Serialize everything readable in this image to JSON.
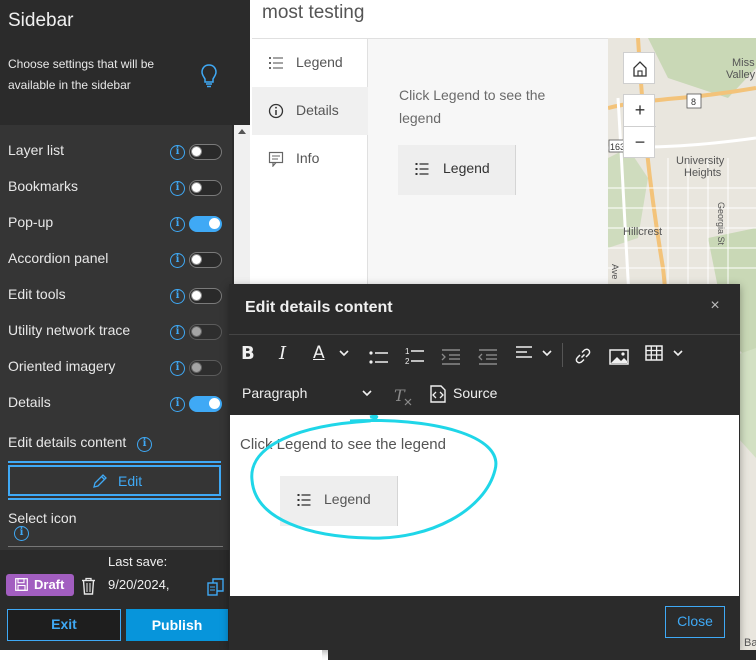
{
  "sidebar": {
    "title": "Sidebar",
    "description": "Choose settings that will be available in the sidebar",
    "items": [
      {
        "label": "Layer list",
        "on": false
      },
      {
        "label": "Bookmarks",
        "on": false
      },
      {
        "label": "Pop-up",
        "on": true
      },
      {
        "label": "Accordion panel",
        "on": false
      },
      {
        "label": "Edit tools",
        "on": false
      },
      {
        "label": "Utility network trace",
        "on": false,
        "disabled": true
      },
      {
        "label": "Oriented imagery",
        "on": false,
        "disabled": true
      },
      {
        "label": "Details",
        "on": true
      }
    ],
    "edit_details_label": "Edit details content",
    "edit_button_label": "Edit",
    "select_icon_label": "Select icon"
  },
  "footer": {
    "draft_label": "Draft",
    "last_save_label": "Last save:",
    "last_save_date": "9/20/2024,",
    "exit_label": "Exit",
    "publish_label": "Publish"
  },
  "preview": {
    "app_title": "most testing",
    "tabs": [
      {
        "label": "Legend",
        "icon": "legend-icon"
      },
      {
        "label": "Details",
        "icon": "info-icon",
        "active": true
      },
      {
        "label": "Info",
        "icon": "comment-icon"
      }
    ],
    "details_message": "Click Legend to see the legend",
    "legend_button_label": "Legend"
  },
  "map": {
    "labels": [
      "Miss",
      "Valley",
      "8",
      "163",
      "University",
      "Heights",
      "Hillcrest",
      "Georgia St",
      "Ave",
      "Ba"
    ],
    "zoom_in": "+",
    "zoom_out": "−"
  },
  "modal": {
    "title": "Edit details content",
    "toolbar": {
      "paragraph_select": "Paragraph",
      "source_label": "Source"
    },
    "editor_message": "Click Legend to see the legend",
    "editor_legend_label": "Legend",
    "close_label": "Close"
  },
  "colors": {
    "accent": "#3fa9f5",
    "draft": "#a25ec0",
    "publish": "#0795db",
    "annotation": "#1fd6e8"
  }
}
